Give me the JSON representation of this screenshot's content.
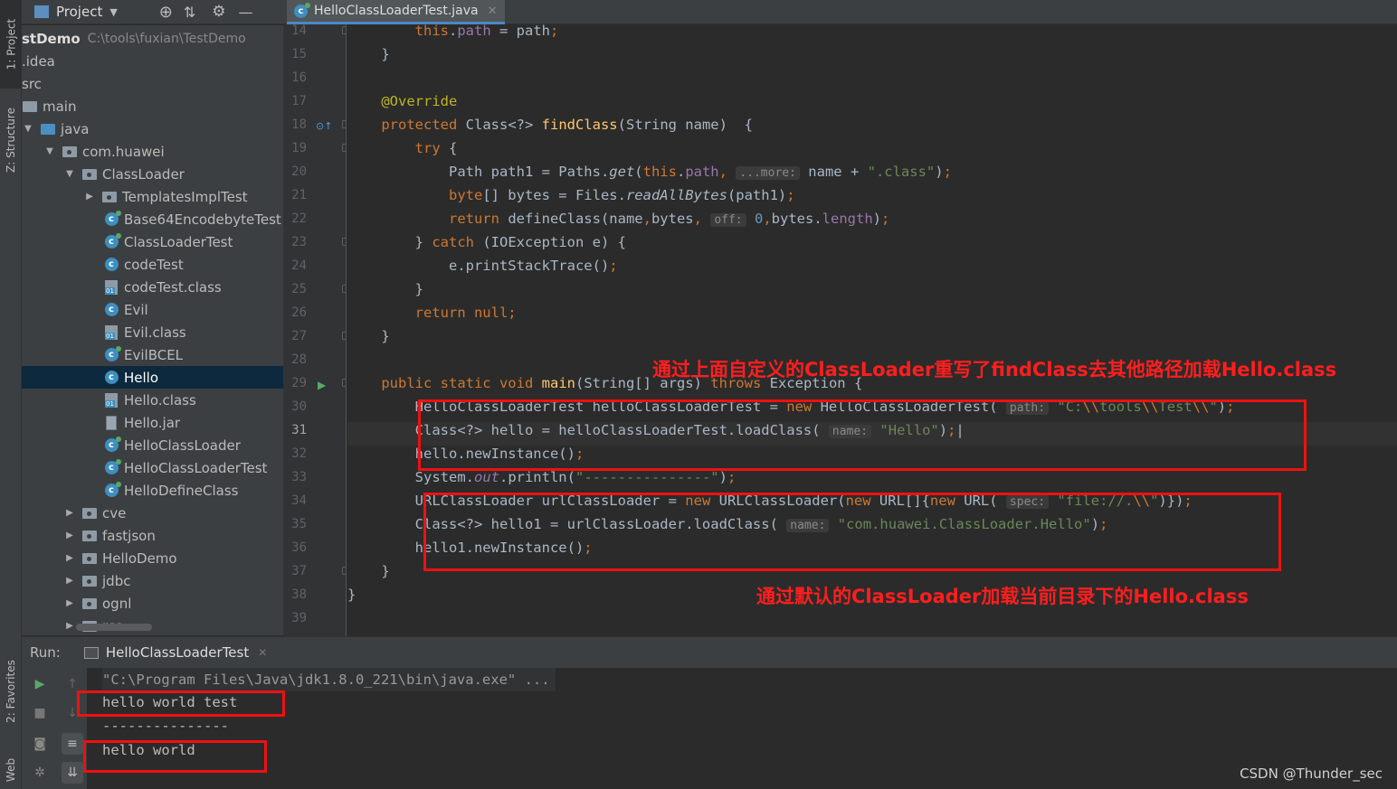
{
  "side_tabs": {
    "project": "1: Project",
    "structure": "Z: Structure",
    "favorites": "2: Favorites",
    "web": "Web"
  },
  "project_panel": {
    "title": "Project",
    "root_name": "stDemo",
    "root_path": "C:\\tools\\fuxian\\TestDemo",
    "items": [
      {
        "label": ".idea"
      },
      {
        "label": "src"
      },
      {
        "label": "main"
      },
      {
        "label": "java"
      },
      {
        "label": "com.huawei"
      },
      {
        "label": "ClassLoader"
      },
      {
        "label": "TemplatesImplTest"
      },
      {
        "label": "Base64EncodebyteTest"
      },
      {
        "label": "ClassLoaderTest"
      },
      {
        "label": "codeTest"
      },
      {
        "label": "codeTest.class"
      },
      {
        "label": "Evil"
      },
      {
        "label": "Evil.class"
      },
      {
        "label": "EvilBCEL"
      },
      {
        "label": "Hello"
      },
      {
        "label": "Hello.class"
      },
      {
        "label": "Hello.jar"
      },
      {
        "label": "HelloClassLoader"
      },
      {
        "label": "HelloClassLoaderTest"
      },
      {
        "label": "HelloDefineClass"
      },
      {
        "label": "cve"
      },
      {
        "label": "fastjson"
      },
      {
        "label": "HelloDemo"
      },
      {
        "label": "jdbc"
      },
      {
        "label": "ognl"
      },
      {
        "label": "rce"
      }
    ],
    "selected": "Hello"
  },
  "editor": {
    "tab_label": "HelloClassLoaderTest.java",
    "current_line": "31",
    "line_numbers": [
      "14",
      "15",
      "16",
      "17",
      "18",
      "19",
      "20",
      "21",
      "22",
      "23",
      "24",
      "25",
      "26",
      "27",
      "28",
      "29",
      "30",
      "31",
      "32",
      "33",
      "34",
      "35",
      "36",
      "37",
      "38",
      "39"
    ]
  },
  "annotations": {
    "top": "通过上面自定义的ClassLoader重写了findClass去其他路径加载Hello.class",
    "bottom": "通过默认的ClassLoader加载当前目录下的Hello.class"
  },
  "run_panel": {
    "label": "Run:",
    "tab": "HelloClassLoaderTest",
    "console_lines": [
      "\"C:\\Program Files\\Java\\jdk1.8.0_221\\bin\\java.exe\" ...",
      "hello world test",
      "---------------",
      "hello world"
    ]
  },
  "watermark": "CSDN @Thunder_sec",
  "colors": {
    "keyword": "#cc7832",
    "string": "#6a8759",
    "method": "#ffc66d",
    "annotation": "#bbb529",
    "field": "#9876aa",
    "number": "#6897bb",
    "highlight_box": "#ee1111",
    "selection": "#0d293e"
  }
}
